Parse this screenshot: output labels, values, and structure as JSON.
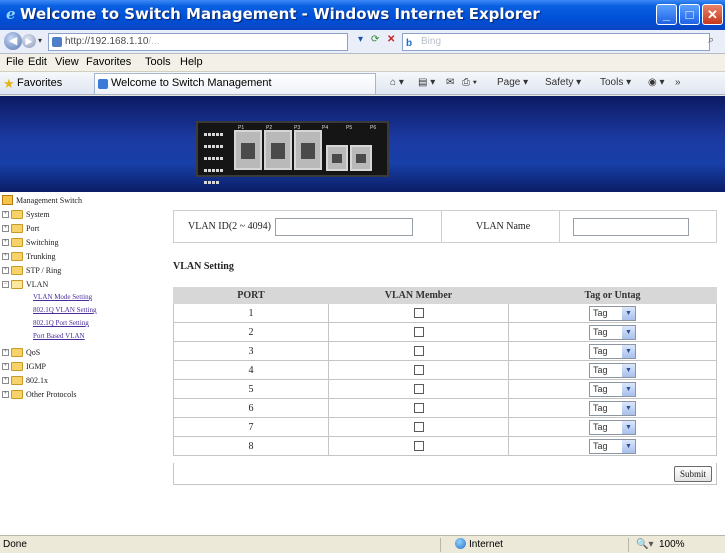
{
  "window": {
    "title": "Welcome to Switch Management - Windows Internet Explorer",
    "buttons": {
      "minimize": "_",
      "maximize": "□",
      "close": "✕"
    }
  },
  "address_bar": {
    "url_visible": "http://192.168.1.10",
    "url_blurred": "/...",
    "search_engine": "Bing"
  },
  "menu": [
    "File",
    "Edit",
    "View",
    "Favorites",
    "Tools",
    "Help"
  ],
  "favorites_bar": {
    "label": "Favorites",
    "tab_title": "Welcome to Switch Management",
    "commands": [
      "Page ▾",
      "Safety ▾",
      "Tools ▾"
    ]
  },
  "banner": {
    "port_labels": [
      "P1",
      "P2",
      "P3",
      "P4",
      "P5",
      "P6"
    ]
  },
  "nav": {
    "root": "Management Switch",
    "items": [
      {
        "label": "System",
        "expanded": false
      },
      {
        "label": "Port",
        "expanded": false
      },
      {
        "label": "Switching",
        "expanded": false
      },
      {
        "label": "Trunking",
        "expanded": false
      },
      {
        "label": "STP / Ring",
        "expanded": false
      },
      {
        "label": "VLAN",
        "expanded": true
      },
      {
        "label": "QoS",
        "expanded": false
      },
      {
        "label": "IGMP",
        "expanded": false
      },
      {
        "label": "802.1x",
        "expanded": false
      },
      {
        "label": "Other Protocols",
        "expanded": false
      }
    ],
    "vlan_children": [
      "VLAN Mode Setting",
      "802.1Q VLAN Setting",
      "802.1Q Port Setting",
      "Port Based VLAN"
    ]
  },
  "form": {
    "vlan_id_label": "VLAN ID(2 ~ 4094)",
    "vlan_id_value": "",
    "vlan_name_label": "VLAN Name",
    "vlan_name_value": "",
    "section_title": "VLAN Setting",
    "table": {
      "headers": [
        "PORT",
        "VLAN Member",
        "Tag or Untag"
      ],
      "rows": [
        {
          "port": "1",
          "member": false,
          "tag": "Tag"
        },
        {
          "port": "2",
          "member": false,
          "tag": "Tag"
        },
        {
          "port": "3",
          "member": false,
          "tag": "Tag"
        },
        {
          "port": "4",
          "member": false,
          "tag": "Tag"
        },
        {
          "port": "5",
          "member": false,
          "tag": "Tag"
        },
        {
          "port": "6",
          "member": false,
          "tag": "Tag"
        },
        {
          "port": "7",
          "member": false,
          "tag": "Tag"
        },
        {
          "port": "8",
          "member": false,
          "tag": "Tag"
        }
      ]
    },
    "submit_label": "Submit"
  },
  "status_bar": {
    "status": "Done",
    "zone": "Internet",
    "zoom": "100%"
  },
  "colors": {
    "titlebar": "#0050d8",
    "banner": "#1b3aa2",
    "table_header": "#d7d7d7"
  }
}
